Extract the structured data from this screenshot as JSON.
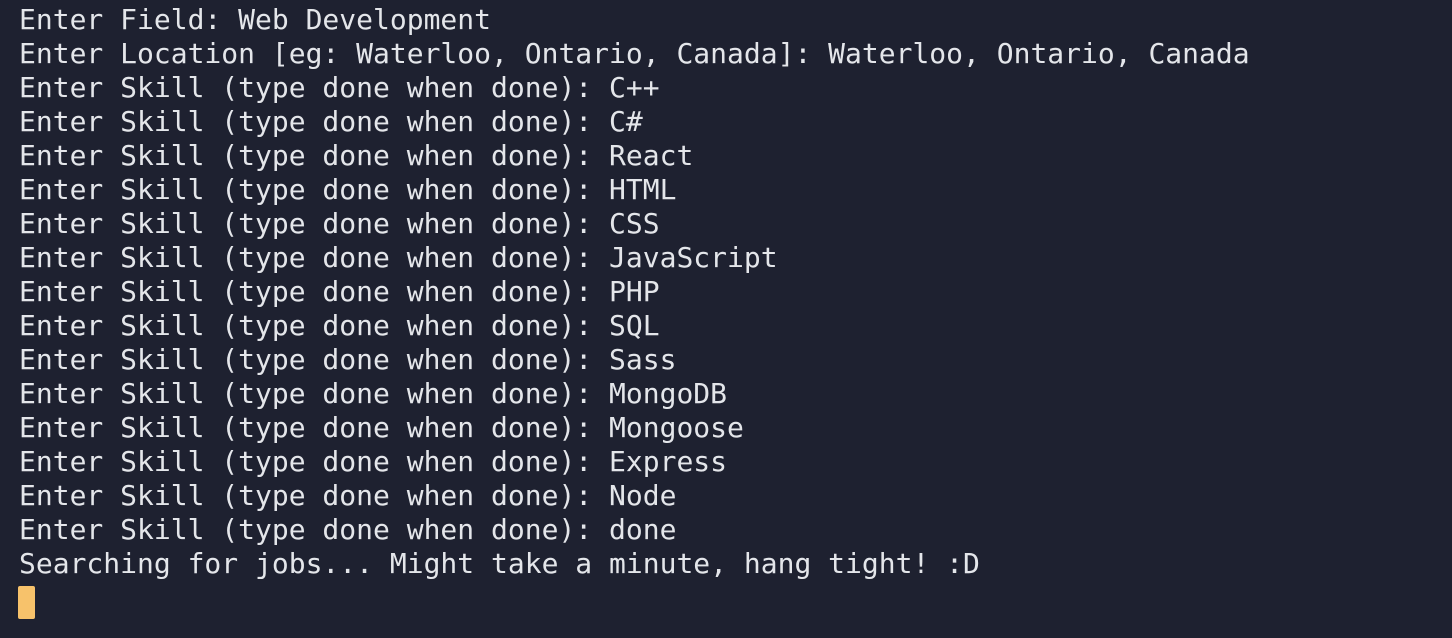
{
  "terminal": {
    "background_color": "#1e2130",
    "text_color": "#e4e6ea",
    "cursor_color": "#f7c26b",
    "lines": [
      "Enter Field: Web Development",
      "Enter Location [eg: Waterloo, Ontario, Canada]: Waterloo, Ontario, Canada",
      "Enter Skill (type done when done): C++",
      "Enter Skill (type done when done): C#",
      "Enter Skill (type done when done): React",
      "Enter Skill (type done when done): HTML",
      "Enter Skill (type done when done): CSS",
      "Enter Skill (type done when done): JavaScript",
      "Enter Skill (type done when done): PHP",
      "Enter Skill (type done when done): SQL",
      "Enter Skill (type done when done): Sass",
      "Enter Skill (type done when done): MongoDB",
      "Enter Skill (type done when done): Mongoose",
      "Enter Skill (type done when done): Express",
      "Enter Skill (type done when done): Node",
      "Enter Skill (type done when done): done",
      "Searching for jobs... Might take a minute, hang tight! :D"
    ]
  }
}
